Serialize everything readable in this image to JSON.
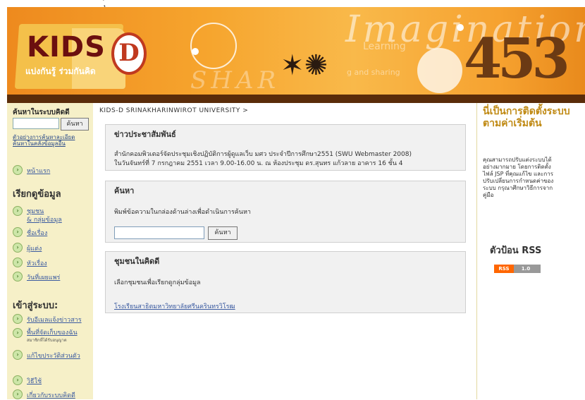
{
  "banner": {
    "logo_text": "KIDS",
    "logo_letter": "D",
    "slogan": "แบ่งกันรู้ ร่วมกันคิด",
    "imagination": "Imagination",
    "learning": "Learning",
    "sharing": "g and sharing",
    "shar": "SHAR",
    "numbers": "453",
    "top_glyph": "ุ้"
  },
  "left": {
    "search_title": "ค้นหาในระบบคิดดี",
    "search_button": "ค้นหา",
    "adv_link_1": "ตัวอย่างการค้นหาละเอียด",
    "adv_link_2": "ค้นหาในคลังข้อมูลอื่น",
    "home": "หน้าแรก",
    "browse_heading": "เรียกดูข้อมูล",
    "browse_items": [
      "ชุมชน",
      "& กลุ่มข้อมูล",
      "ชื่อเรื่อง",
      "ผู้แต่ง",
      "หัวเรื่อง",
      "วันที่เผยแพร่"
    ],
    "login_heading": "เข้าสู่ระบบ:",
    "login_items": [
      "รับอีเมลแจ้งข่าวสาร",
      "พื้นที่จัดเก็บของฉัน",
      "แก้ไขประวัติส่วนตัว"
    ],
    "login_sub": "สมาชิกที่ได้รับอนุญาต",
    "bottom_items": [
      "วิธีใช้",
      "เกี่ยวกับระบบคิดดี"
    ]
  },
  "main": {
    "breadcrumb": "KIDS-D SRINAKHARINWIROT UNIVERSITY >",
    "news": {
      "title": "ข่าวประชาสัมพันธ์",
      "line1": "สำนักคอมพิวเตอร์จัดประชุมเชิงปฏิบัติการผู้ดูแลเว็บ มศว ประจำปีการศึกษา2551 (SWU Webmaster 2008)",
      "line2": "ในวันจันทร์ที่ 7 กรกฎาคม 2551 เวลา 9.00-16.00 น. ณ ห้องประชุม ดร.สุนทร แก้วลาย อาคาร 16 ชั้น 4"
    },
    "search": {
      "title": "ค้นหา",
      "text": "พิมพ์ข้อความในกล่องด้านล่างเพื่อดำเนินการค้นหา",
      "button": "ค้นหา"
    },
    "communities": {
      "title": "ชุมชนในคิดดี",
      "text": "เลือกชุมชนเพื่อเรียกดูกลุ่มข้อมูล",
      "link": "โรงเรียนสาธิตมหาวิทยาลัยศรีนครินทรวิโรฒ"
    }
  },
  "right": {
    "title": "นี่เป็นการติดตั้งระบบตามค่าเริ่มต้น",
    "text": "คุณสามารถปรับแต่งระบบได้อย่างมากมาย โดยการติดตั้งไฟล์ JSP ที่คุณแก้ไข และการปรับเปลี่ยนการกำหนดค่าของระบบ กรุณาศึกษาวิธีการจากคู่มือ",
    "rss_heading": "ตัวป้อน RSS",
    "rss_left": "RSS",
    "rss_right": "1.0"
  },
  "colors": {
    "banner_orange": "#f6a52e",
    "nav_brown": "#5a2c0a",
    "sidebar_cream": "#f6f0c8",
    "link_blue": "#3a5aa0",
    "title_gold": "#c08a14"
  }
}
